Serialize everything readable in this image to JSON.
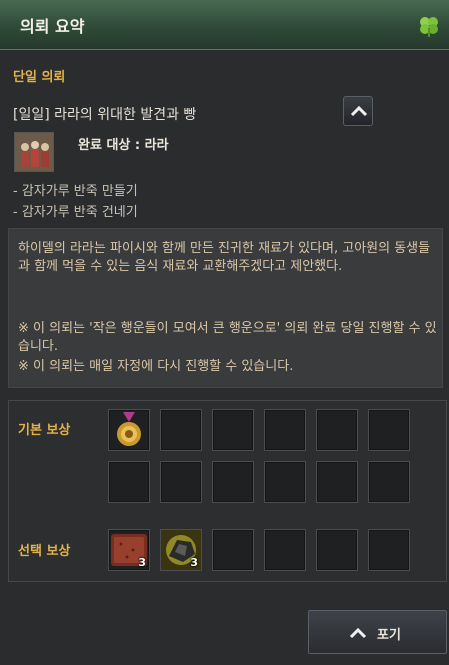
{
  "window": {
    "title": "의뢰 요약",
    "corner_icon": "clover-icon"
  },
  "section": {
    "title": "단일 의뢰"
  },
  "quest": {
    "title": "[일일] 라라의 위대한 발견과 빵",
    "target": "완료 대상 : 라라",
    "objectives": [
      "- 감자가루 반죽 만들기",
      "- 감자가루 반죽 건네기"
    ],
    "description": "하이델의 라라는 파이시와 함께 만든 진귀한 재료가 있다며, 고아원의 동생들과 함께 먹을 수 있는 음식 재료와 교환해주겠다고 제안했다.",
    "notes": [
      "※ 이 의뢰는 '작은 행운들이 모여서 큰 행운으로' 의뢰 완료 당일 진행할 수 있습니다.",
      "※ 이 의뢰는 매일 자정에 다시 진행할 수 있습니다."
    ]
  },
  "rewards": {
    "basic_label": "기본 보상",
    "basic_items": [
      {
        "icon": "medal-icon",
        "count": ""
      }
    ],
    "choice_label": "선택 보상",
    "choice_items": [
      {
        "icon": "dough-icon",
        "count": "3"
      },
      {
        "icon": "ore-icon",
        "count": "3"
      }
    ]
  },
  "buttons": {
    "giveup": "포기"
  },
  "colors": {
    "accent": "#e3b24a",
    "titlebar": "#2f4a38"
  }
}
